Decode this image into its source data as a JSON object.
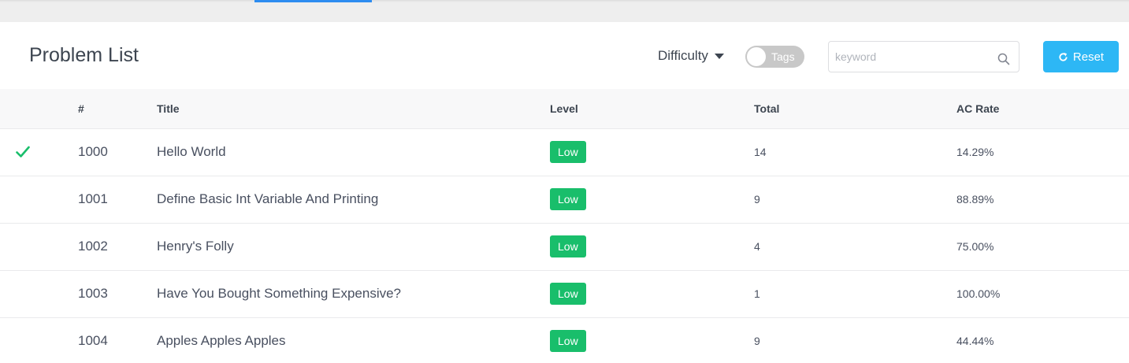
{
  "header": {
    "title": "Problem List",
    "difficulty_label": "Difficulty",
    "tags_toggle_label": "Tags",
    "tags_toggle_on": false,
    "search_placeholder": "keyword",
    "search_value": "",
    "reset_label": "Reset"
  },
  "colors": {
    "accent": "#2d8cf0",
    "reset_button": "#2db7f5",
    "level_low": "#19be6b",
    "solved_check": "#19be6b"
  },
  "table": {
    "columns": [
      "",
      "#",
      "Title",
      "Level",
      "Total",
      "AC Rate"
    ],
    "rows": [
      {
        "solved": true,
        "id": "1000",
        "title": "Hello World",
        "level": "Low",
        "total": "14",
        "ac_rate": "14.29%"
      },
      {
        "solved": false,
        "id": "1001",
        "title": "Define Basic Int Variable And Printing",
        "level": "Low",
        "total": "9",
        "ac_rate": "88.89%"
      },
      {
        "solved": false,
        "id": "1002",
        "title": "Henry's Folly",
        "level": "Low",
        "total": "4",
        "ac_rate": "75.00%"
      },
      {
        "solved": false,
        "id": "1003",
        "title": "Have You Bought Something Expensive?",
        "level": "Low",
        "total": "1",
        "ac_rate": "100.00%"
      },
      {
        "solved": false,
        "id": "1004",
        "title": "Apples Apples Apples",
        "level": "Low",
        "total": "9",
        "ac_rate": "44.44%"
      }
    ]
  }
}
